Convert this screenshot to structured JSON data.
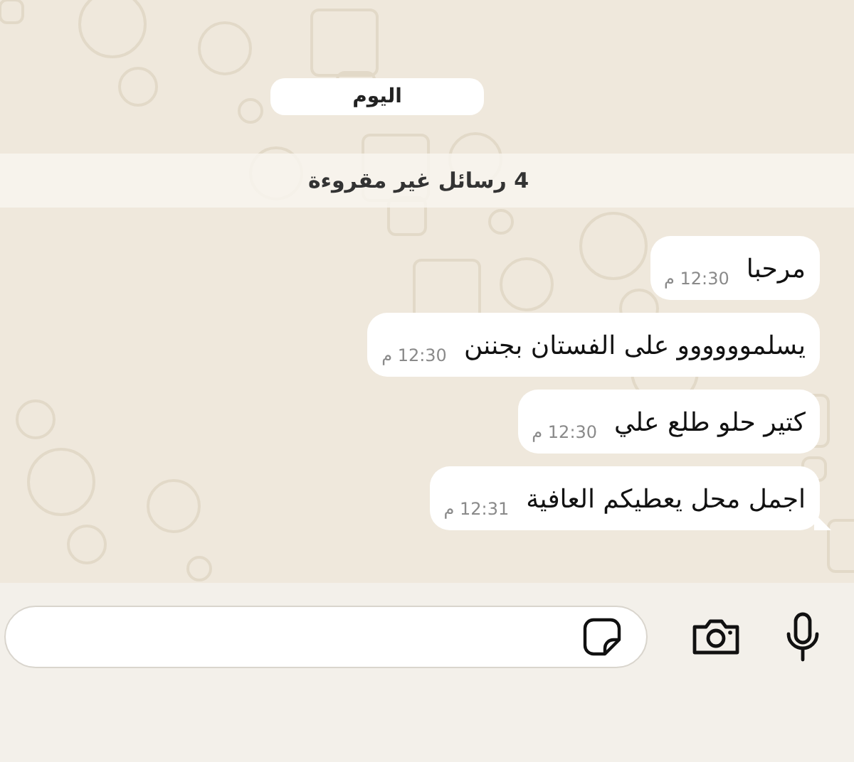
{
  "date_pill": "اليوم",
  "unread_banner": "4 رسائل غير مقروءة",
  "messages": [
    {
      "text": "مرحبا",
      "time": "12:30 م"
    },
    {
      "text": "يسلموووووو على الفستان بجننن",
      "time": "12:30 م"
    },
    {
      "text": "كتير حلو طلع علي",
      "time": "12:30 م"
    },
    {
      "text": "اجمل محل يعطيكم العافية",
      "time": "12:31 م"
    }
  ]
}
